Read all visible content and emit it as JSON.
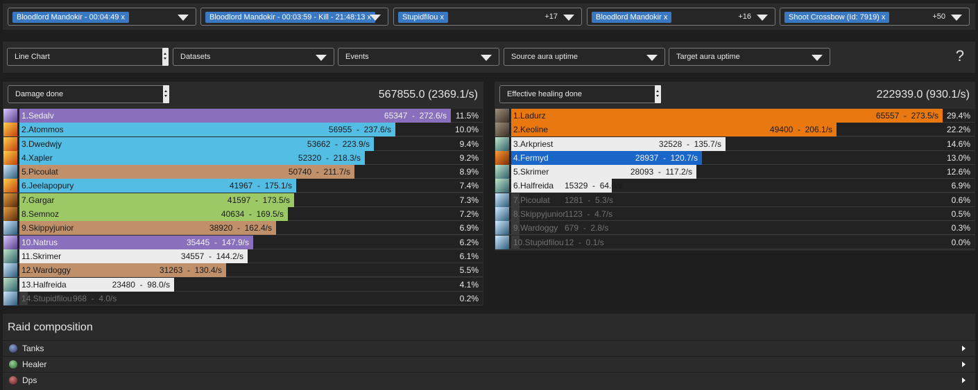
{
  "filters": [
    {
      "tag": "Bloodlord Mandokir - 00:04:49",
      "count": ""
    },
    {
      "tag": "Bloodlord Mandokir - 00:03:59 - Kill - 21:48:13",
      "count": ""
    },
    {
      "tag": "Stupidfilou",
      "count": "+17"
    },
    {
      "tag": "Bloodlord Mandokir",
      "count": "+16"
    },
    {
      "tag": "Shoot Crossbow (Id: 7919)",
      "count": "+50"
    }
  ],
  "remove_mark": "x",
  "options": {
    "chart_type": "Line Chart",
    "datasets": "Datasets",
    "events": "Events",
    "source_aura": "Source aura uptime",
    "target_aura": "Target aura uptime",
    "help": "?"
  },
  "damage": {
    "metric": "Damage done",
    "total": "567855.0 (2369.1/s)",
    "max": 65347,
    "rows": [
      {
        "name": "1.Sedalv",
        "amount": 65347,
        "rate": "272.6/s",
        "pct": "11.5%",
        "color": "#8a6fbd",
        "icon": "sword-icon",
        "dim": false
      },
      {
        "name": "2.Atommos",
        "amount": 56955,
        "rate": "237.6/s",
        "pct": "10.0%",
        "color": "#53bde4",
        "icon": "fire-icon",
        "dim": false
      },
      {
        "name": "3.Dwedwjy",
        "amount": 53662,
        "rate": "223.9/s",
        "pct": "9.4%",
        "color": "#53bde4",
        "icon": "fire-icon",
        "dim": false
      },
      {
        "name": "4.Xapler",
        "amount": 52320,
        "rate": "218.3/s",
        "pct": "9.2%",
        "color": "#53bde4",
        "icon": "fire-icon",
        "dim": false
      },
      {
        "name": "5.Picoulat",
        "amount": 50740,
        "rate": "211.7/s",
        "pct": "8.9%",
        "color": "#c0906a",
        "icon": "blade-icon",
        "dim": false
      },
      {
        "name": "6.Jeelapopury",
        "amount": 41967,
        "rate": "175.1/s",
        "pct": "7.4%",
        "color": "#53bde4",
        "icon": "fire-icon",
        "dim": false
      },
      {
        "name": "7.Gargar",
        "amount": 41597,
        "rate": "173.5/s",
        "pct": "7.3%",
        "color": "#9cc865",
        "icon": "bow-icon",
        "dim": false
      },
      {
        "name": "8.Semnoz",
        "amount": 40634,
        "rate": "169.5/s",
        "pct": "7.2%",
        "color": "#9cc865",
        "icon": "bow-icon",
        "dim": false
      },
      {
        "name": "9.Skippyjunior",
        "amount": 38920,
        "rate": "162.4/s",
        "pct": "6.9%",
        "color": "#c0906a",
        "icon": "blade-icon",
        "dim": false
      },
      {
        "name": "10.Natrus",
        "amount": 35445,
        "rate": "147.9/s",
        "pct": "6.2%",
        "color": "#8a6fbd",
        "icon": "sword-icon",
        "dim": false
      },
      {
        "name": "11.Skrimer",
        "amount": 34557,
        "rate": "144.2/s",
        "pct": "6.1%",
        "color": "#ececec",
        "icon": "staff-icon",
        "dim": false
      },
      {
        "name": "12.Wardoggy",
        "amount": 31263,
        "rate": "130.4/s",
        "pct": "5.5%",
        "color": "#c0906a",
        "icon": "blade-icon",
        "dim": false
      },
      {
        "name": "13.Halfreida",
        "amount": 23480,
        "rate": "98.0/s",
        "pct": "4.1%",
        "color": "#ececec",
        "icon": "staff-icon",
        "dim": false
      },
      {
        "name": "14.Stupidfilou",
        "amount": 968,
        "rate": "4.0/s",
        "pct": "0.2%",
        "color": "#3a3a3a",
        "icon": "blade-icon",
        "dim": true
      }
    ]
  },
  "healing": {
    "metric": "Effective healing done",
    "total": "222939.0 (930.1/s)",
    "max": 65557,
    "rows": [
      {
        "name": "1.Ladurz",
        "amount": 65557,
        "rate": "273.5/s",
        "pct": "29.4%",
        "color": "#e8780f",
        "icon": "claw-icon",
        "dim": false
      },
      {
        "name": "2.Keoline",
        "amount": 49400,
        "rate": "206.1/s",
        "pct": "22.2%",
        "color": "#e8780f",
        "icon": "claw-icon",
        "dim": false
      },
      {
        "name": "3.Arkpriest",
        "amount": 32528,
        "rate": "135.7/s",
        "pct": "14.6%",
        "color": "#ececec",
        "icon": "staff-icon",
        "dim": false
      },
      {
        "name": "4.Fermyd",
        "amount": 28937,
        "rate": "120.7/s",
        "pct": "13.0%",
        "color": "#1a66c8",
        "icon": "shaman-icon",
        "dim": false
      },
      {
        "name": "5.Skrimer",
        "amount": 28093,
        "rate": "117.2/s",
        "pct": "12.6%",
        "color": "#ececec",
        "icon": "staff-icon",
        "dim": false
      },
      {
        "name": "6.Halfreida",
        "amount": 15329,
        "rate": "64.0/s",
        "pct": "6.9%",
        "color": "#ececec",
        "icon": "staff-icon",
        "dim": false
      },
      {
        "name": "7.Picoulat",
        "amount": 1281,
        "rate": "5.3/s",
        "pct": "0.6%",
        "color": "#3a3a3a",
        "icon": "blade-icon",
        "dim": true
      },
      {
        "name": "8.Skippyjunior",
        "amount": 1123,
        "rate": "4.7/s",
        "pct": "0.5%",
        "color": "#3a3a3a",
        "icon": "blade-icon",
        "dim": true
      },
      {
        "name": "9.Wardoggy",
        "amount": 679,
        "rate": "2.8/s",
        "pct": "0.3%",
        "color": "#3a3a3a",
        "icon": "blade-icon",
        "dim": true
      },
      {
        "name": "10.Stupidfilou",
        "amount": 12,
        "rate": "0.1/s",
        "pct": "0.0%",
        "color": "#3a3a3a",
        "icon": "blade-icon",
        "dim": true
      }
    ]
  },
  "raid": {
    "title": "Raid composition",
    "groups": [
      {
        "label": "Tanks",
        "icon": "shield-icon",
        "color": "#4a5a8a"
      },
      {
        "label": "Healer",
        "icon": "plus-icon",
        "color": "#3f8f3f"
      },
      {
        "label": "Dps",
        "icon": "crosshair-icon",
        "color": "#8f3030"
      }
    ]
  }
}
